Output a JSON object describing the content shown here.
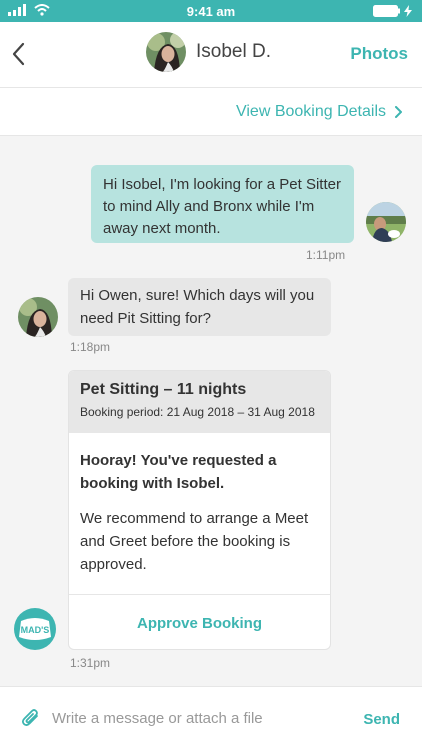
{
  "status_bar": {
    "time": "9:41 am",
    "accent_color": "#3db5b1"
  },
  "header": {
    "contact_name": "Isobel D.",
    "photos_label": "Photos"
  },
  "booking_bar": {
    "link_label": "View Booking Details"
  },
  "messages": [
    {
      "from": "Owen",
      "text": "Hi Isobel, I'm looking for a Pet Sitter to mind Ally and Bronx while I'm away next month.",
      "time": "1:11pm"
    },
    {
      "from": "Isobel",
      "text": "Hi Owen, sure! Which days will you need Pit Sitting for?",
      "time": "1:18pm"
    }
  ],
  "booking_card": {
    "title": "Pet Sitting – 11 nights",
    "period": "Booking period: 21 Aug 2018 – 31 Aug 2018",
    "headline": "Hooray! You've requested a booking with Isobel.",
    "body": "We recommend to arrange a Meet and Greet before the booking is approved.",
    "action_label": "Approve Booking",
    "time": "1:31pm"
  },
  "composer": {
    "placeholder": "Write a message or attach a file",
    "send_label": "Send"
  },
  "logo_text": "MAD'S"
}
